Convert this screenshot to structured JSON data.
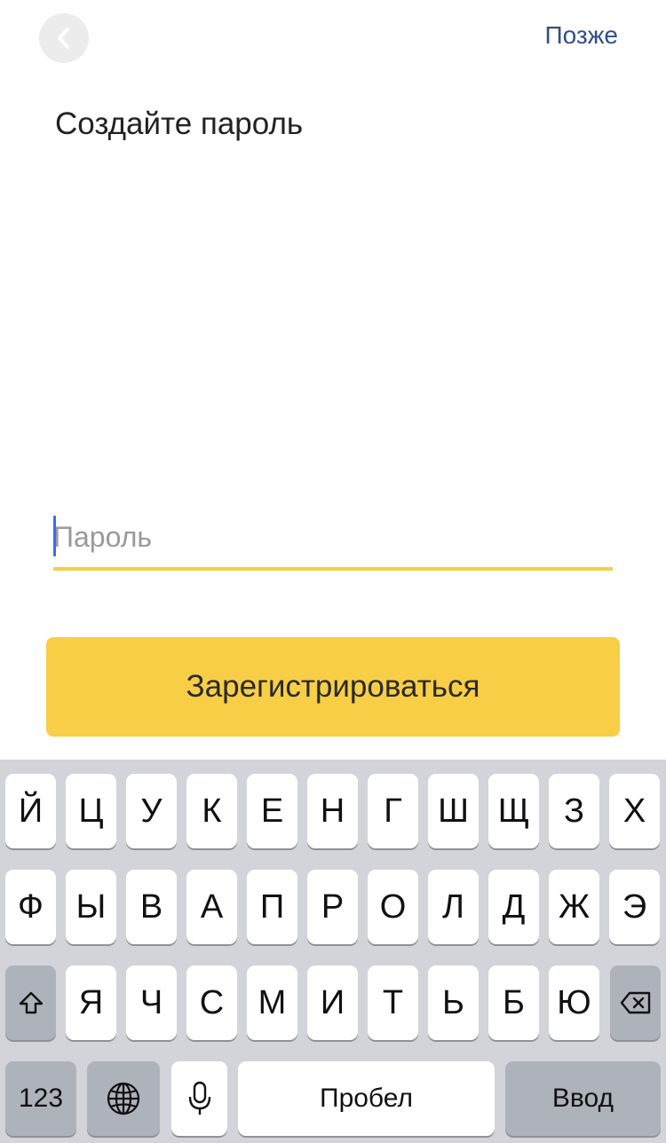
{
  "header": {
    "back_icon": "chevron-left-icon",
    "later_label": "Позже"
  },
  "title": "Создайте пароль",
  "password_field": {
    "value": "",
    "placeholder": "Пароль"
  },
  "register_button_label": "Зарегистрироваться",
  "colors": {
    "accent": "#f7ce45",
    "link": "#2f4e8a",
    "caret": "#3a6df0",
    "keyboard_bg": "#d2d4da"
  },
  "keyboard": {
    "row1": [
      "Й",
      "Ц",
      "У",
      "К",
      "Е",
      "Н",
      "Г",
      "Ш",
      "Щ",
      "З",
      "Х"
    ],
    "row2": [
      "Ф",
      "Ы",
      "В",
      "А",
      "П",
      "Р",
      "О",
      "Л",
      "Д",
      "Ж",
      "Э"
    ],
    "row3": [
      "Я",
      "Ч",
      "С",
      "М",
      "И",
      "Т",
      "Ь",
      "Б",
      "Ю"
    ],
    "shift_icon": "shift-arrow-icon",
    "backspace_icon": "backspace-icon",
    "numbers_label": "123",
    "globe_icon": "globe-icon",
    "mic_icon": "microphone-icon",
    "space_label": "Пробел",
    "return_label": "Ввод"
  }
}
